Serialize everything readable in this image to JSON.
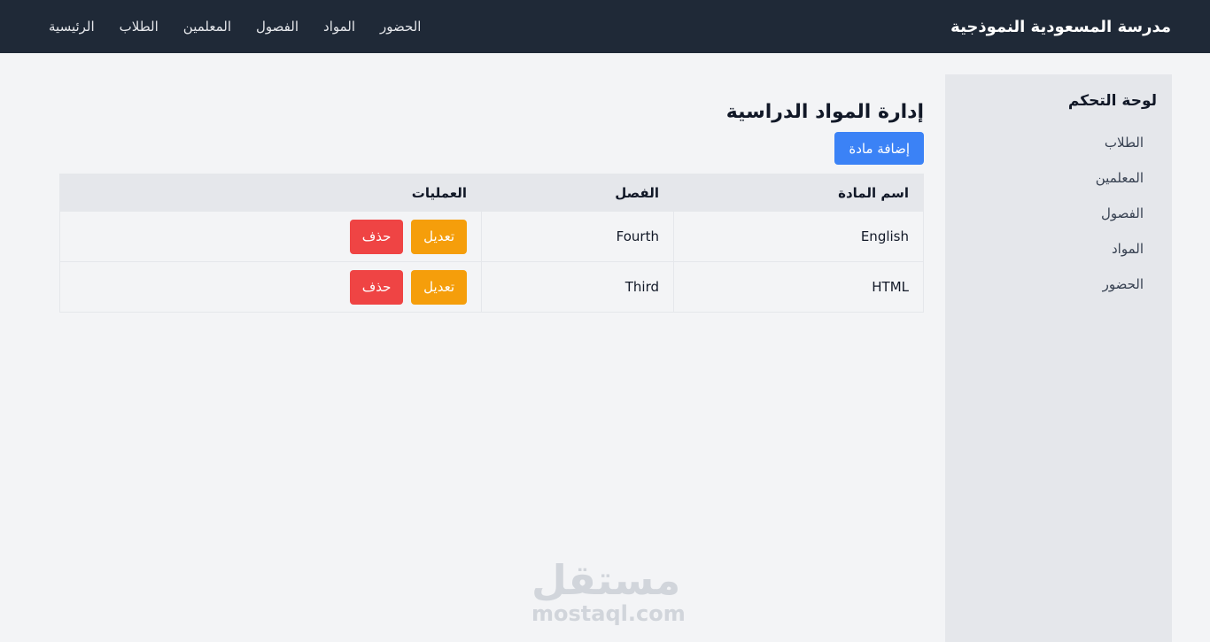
{
  "navbar": {
    "brand": "مدرسة المسعودية النموذجية",
    "links": [
      "الرئيسية",
      "الطلاب",
      "المعلمين",
      "الفصول",
      "المواد",
      "الحضور"
    ]
  },
  "sidebar": {
    "title": "لوحة التحكم",
    "items": [
      "الطلاب",
      "المعلمين",
      "الفصول",
      "المواد",
      "الحضور"
    ]
  },
  "main": {
    "title": "إدارة المواد الدراسية",
    "add_button": "إضافة مادة",
    "table": {
      "headers": [
        "اسم المادة",
        "الفصل",
        "العمليات"
      ],
      "rows": [
        {
          "name": "English",
          "class": "Fourth",
          "edit": "تعديل",
          "delete": "حذف"
        },
        {
          "name": "HTML",
          "class": "Third",
          "edit": "تعديل",
          "delete": "حذف"
        }
      ]
    }
  },
  "watermark": {
    "arabic": "مستقل",
    "latin": "mostaql.com"
  }
}
